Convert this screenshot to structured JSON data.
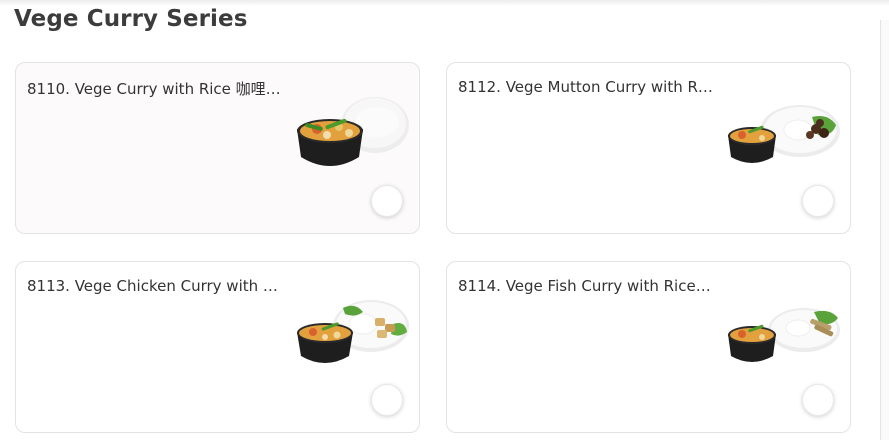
{
  "section": {
    "title": "Vege Curry Series"
  },
  "items": [
    {
      "title": "8110. Vege Curry with Rice 咖哩…",
      "image": "curry-rice-dish",
      "side": "plain-rice"
    },
    {
      "title": "8112. Vege Mutton Curry with R…",
      "image": "mutton-curry-dish",
      "side": "mutton"
    },
    {
      "title": "8113. Vege Chicken Curry with …",
      "image": "chicken-curry-dish",
      "side": "chicken"
    },
    {
      "title": "8114. Vege Fish Curry with Rice …",
      "image": "fish-curry-dish",
      "side": "fish"
    }
  ]
}
